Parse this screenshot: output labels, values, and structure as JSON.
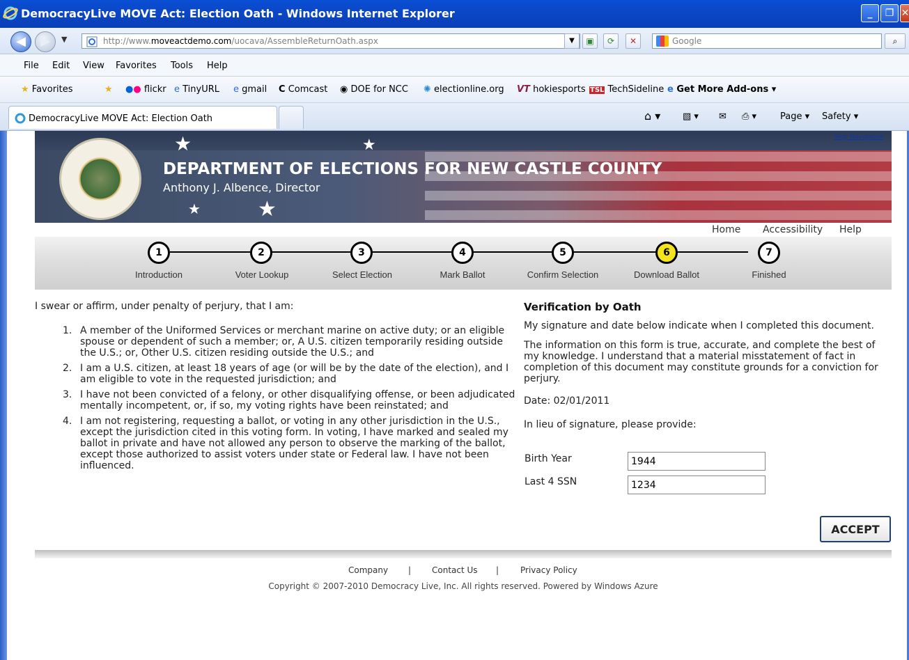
{
  "window": {
    "title": "DemocracyLive MOVE Act: Election Oath - Windows Internet Explorer"
  },
  "browser": {
    "url_prefix": "http://www.",
    "url_domain": "moveactdemo.com",
    "url_path": "/uocava/AssembleReturnOath.aspx",
    "search_placeholder": "Google",
    "menu": [
      "File",
      "Edit",
      "View",
      "Favorites",
      "Tools",
      "Help"
    ],
    "favorites_label": "Favorites",
    "favorites": [
      "flickr",
      "TinyURL",
      "gmail",
      "Comcast",
      "DOE for NCC",
      "electionline.org",
      "hokiesports",
      "TechSideline",
      "Get More Add-ons"
    ],
    "tab_title": "DemocracyLive MOVE Act: Election Oath",
    "commands": {
      "page": "Page",
      "safety": "Safety"
    }
  },
  "header": {
    "title": "DEPARTMENT OF ELECTIONS FOR NEW CASTLE COUNTY",
    "director": "Anthony J. Albence, Director",
    "skip_nav": "Skip Navigation",
    "links": [
      "Home",
      "Accessibility",
      "Help"
    ]
  },
  "steps": [
    {
      "num": "1",
      "label": "Introduction"
    },
    {
      "num": "2",
      "label": "Voter Lookup"
    },
    {
      "num": "3",
      "label": "Select Election"
    },
    {
      "num": "4",
      "label": "Mark Ballot"
    },
    {
      "num": "5",
      "label": "Confirm Selection"
    },
    {
      "num": "6",
      "label": "Download Ballot"
    },
    {
      "num": "7",
      "label": "Finished"
    }
  ],
  "oath": {
    "intro": "I swear or affirm, under penalty of perjury, that I am:",
    "items": [
      {
        "num": "1.",
        "text": "A member of the Uniformed Services or merchant marine on active duty; or an eligible spouse or dependent of such a member; or, A U.S. citizen temporarily residing outside the U.S.; or, Other U.S. citizen residing outside the U.S.; and"
      },
      {
        "num": "2.",
        "text": "I am a U.S. citizen, at least 18 years of age (or will be by the date of the election), and I am eligible to vote in the requested jurisdiction; and"
      },
      {
        "num": "3.",
        "text": "I have not been convicted of a felony, or other disqualifying offense, or been adjudicated mentally incompetent, or, if so, my voting rights have been reinstated; and"
      },
      {
        "num": "4.",
        "text": "I am not registering, requesting a ballot, or voting in any other jurisdiction in the U.S., except the jurisdiction cited in this voting form. In voting, I have marked and sealed my ballot in private and have not allowed any person to observe the marking of the ballot, except those authorized to assist voters under state or Federal law. I have not been influenced."
      }
    ]
  },
  "verification": {
    "title": "Verification by Oath",
    "para1": "My signature and date below indicate when I completed this document.",
    "para2": "The information on this form is true, accurate, and complete the best of my knowledge. I understand that a material misstatement of fact in completion of this document may constitute grounds for a conviction for perjury.",
    "date": "Date: 02/01/2011",
    "lieu": "In lieu of signature, please provide:",
    "birth_label": "Birth Year",
    "birth_value": "1944",
    "ssn_label": "Last 4 SSN",
    "ssn_value": "1234",
    "accept": "ACCEPT"
  },
  "footer": {
    "links": [
      "Company",
      "|",
      "Contact Us",
      "|",
      "Privacy Policy"
    ],
    "copyright": "Copyright © 2007-2010 Democracy Live, Inc. All rights reserved. Powered by Windows Azure"
  },
  "colors": {
    "active_step": "#f4e41e",
    "titlebar": "#0a4fd4",
    "banner_red": "#b13c44"
  }
}
